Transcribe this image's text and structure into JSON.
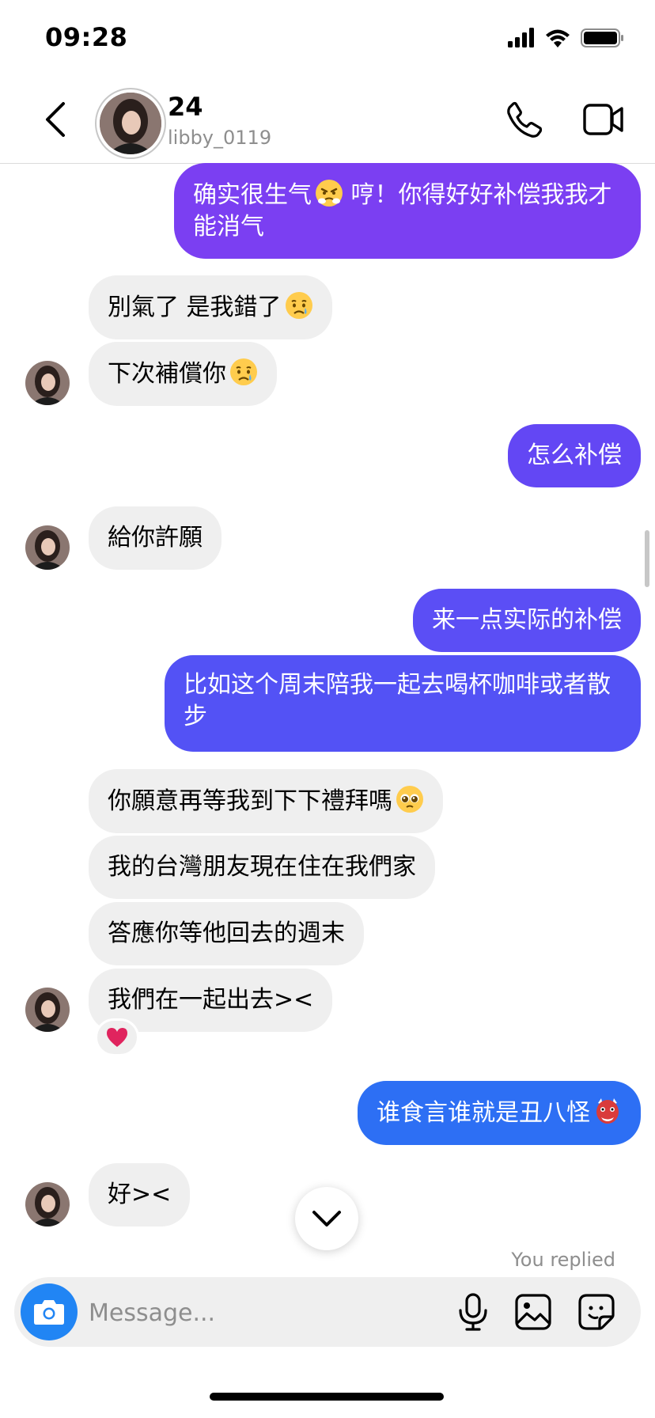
{
  "status_bar": {
    "time": "09:28",
    "icons": [
      "cellular-icon",
      "wifi-icon",
      "battery-icon"
    ]
  },
  "header": {
    "name": "24",
    "username": "libby_0119",
    "avatar_icon": "profile-photo",
    "actions": [
      "back-icon",
      "phone-icon",
      "video-camera-icon"
    ]
  },
  "messages": [
    {
      "from": "me",
      "text": "确实很生气",
      "emoji": "angry-face",
      "text2": " 哼！你得好好补偿我我才能消气"
    },
    {
      "from": "them",
      "text": "別氣了 是我錯了",
      "emoji": "crying-face"
    },
    {
      "from": "them",
      "text": "下次補償你",
      "emoji": "crying-face"
    },
    {
      "from": "me",
      "text": "怎么补偿"
    },
    {
      "from": "them",
      "text": "給你許願"
    },
    {
      "from": "me",
      "text": "来一点实际的补偿"
    },
    {
      "from": "me",
      "text": "比如这个周末陪我一起去喝杯咖啡或者散步"
    },
    {
      "from": "them",
      "text": "你願意再等我到下下禮拜嗎",
      "emoji": "pleading-face"
    },
    {
      "from": "them",
      "text": "我的台灣朋友現在住在我們家"
    },
    {
      "from": "them",
      "text": "答應你等他回去的週末"
    },
    {
      "from": "them",
      "text": "我們在一起出去><",
      "reaction": "red-heart"
    },
    {
      "from": "me",
      "text": "谁食言谁就是丑八怪",
      "emoji": "ogre-face"
    },
    {
      "from": "them",
      "text": "好><"
    }
  ],
  "reply_status": "You replied",
  "composer": {
    "placeholder": "Message...",
    "icons": [
      "camera-icon",
      "microphone-icon",
      "gallery-icon",
      "sticker-icon"
    ]
  },
  "colors": {
    "bubble_in": "#efefef",
    "bubble_out_top": "#7b3ff2",
    "bubble_out_mid": "#5b4ef5",
    "bubble_out_bottom": "#2d6ff4",
    "camera_button": "#2185f4",
    "secondary_text": "#8e8e8e"
  }
}
